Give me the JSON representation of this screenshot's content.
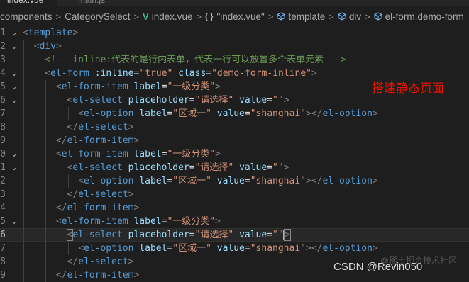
{
  "tabs": {
    "active": "index.vue",
    "inactive": "main.js"
  },
  "breadcrumb": {
    "items": [
      "components",
      "CategorySelect",
      "index.vue",
      "\"index.vue\"",
      "template",
      "div",
      "el-form.demo-form"
    ],
    "icons": [
      "vue-icon",
      "braces-icon",
      "cube-icon"
    ]
  },
  "editor": {
    "line_numbers": [
      "1",
      "2",
      "3",
      "4",
      "5",
      "6",
      "7",
      "8",
      "9",
      "0",
      "1",
      "2",
      "3",
      "4",
      "5",
      "6",
      "7",
      "8",
      "9"
    ],
    "current_line_index": 15,
    "lines": [
      [
        [
          "brk",
          "<"
        ],
        [
          "tag",
          "template"
        ],
        [
          "brk",
          ">"
        ]
      ],
      [
        [
          "brk",
          "<"
        ],
        [
          "tag",
          "div"
        ],
        [
          "brk",
          ">"
        ]
      ],
      [
        [
          "cmt",
          "<!-- inline:代表的是行内表单，代表一行可以放置多个表单元素 -->"
        ]
      ],
      [
        [
          "brk",
          "<"
        ],
        [
          "tag",
          "el-form"
        ],
        [
          "plain",
          " "
        ],
        [
          "attr",
          ":inline"
        ],
        [
          "plain",
          "="
        ],
        [
          "str",
          "\"true\""
        ],
        [
          "plain",
          " "
        ],
        [
          "attr",
          "class"
        ],
        [
          "plain",
          "="
        ],
        [
          "str",
          "\"demo-form-inline\""
        ],
        [
          "brk",
          ">"
        ]
      ],
      [
        [
          "brk",
          "<"
        ],
        [
          "tag",
          "el-form-item"
        ],
        [
          "plain",
          " "
        ],
        [
          "attr",
          "label"
        ],
        [
          "plain",
          "="
        ],
        [
          "str",
          "\"一级分类\""
        ],
        [
          "brk",
          ">"
        ]
      ],
      [
        [
          "brk",
          "<"
        ],
        [
          "tag",
          "el-select"
        ],
        [
          "plain",
          " "
        ],
        [
          "attr",
          "placeholder"
        ],
        [
          "plain",
          "="
        ],
        [
          "str",
          "\"请选择\""
        ],
        [
          "plain",
          " "
        ],
        [
          "attr",
          "value"
        ],
        [
          "plain",
          "="
        ],
        [
          "str",
          "\"\""
        ],
        [
          "brk",
          ">"
        ]
      ],
      [
        [
          "brk",
          "<"
        ],
        [
          "tag",
          "el-option"
        ],
        [
          "plain",
          " "
        ],
        [
          "attr",
          "label"
        ],
        [
          "plain",
          "="
        ],
        [
          "str",
          "\"区域一\""
        ],
        [
          "plain",
          " "
        ],
        [
          "attr",
          "value"
        ],
        [
          "plain",
          "="
        ],
        [
          "str",
          "\"shanghai\""
        ],
        [
          "brk",
          "></"
        ],
        [
          "tag",
          "el-option"
        ],
        [
          "brk",
          ">"
        ]
      ],
      [
        [
          "brk",
          "</"
        ],
        [
          "tag",
          "el-select"
        ],
        [
          "brk",
          ">"
        ]
      ],
      [
        [
          "brk",
          "</"
        ],
        [
          "tag",
          "el-form-item"
        ],
        [
          "brk",
          ">"
        ]
      ],
      [
        [
          "brk",
          "<"
        ],
        [
          "tag",
          "el-form-item"
        ],
        [
          "plain",
          " "
        ],
        [
          "attr",
          "label"
        ],
        [
          "plain",
          "="
        ],
        [
          "str",
          "\"一级分类\""
        ],
        [
          "brk",
          ">"
        ]
      ],
      [
        [
          "brk",
          "<"
        ],
        [
          "tag",
          "el-select"
        ],
        [
          "plain",
          " "
        ],
        [
          "attr",
          "placeholder"
        ],
        [
          "plain",
          "="
        ],
        [
          "str",
          "\"请选择\""
        ],
        [
          "plain",
          " "
        ],
        [
          "attr",
          "value"
        ],
        [
          "plain",
          "="
        ],
        [
          "str",
          "\"\""
        ],
        [
          "brk",
          ">"
        ]
      ],
      [
        [
          "brk",
          "<"
        ],
        [
          "tag",
          "el-option"
        ],
        [
          "plain",
          " "
        ],
        [
          "attr",
          "label"
        ],
        [
          "plain",
          "="
        ],
        [
          "str",
          "\"区域一\""
        ],
        [
          "plain",
          " "
        ],
        [
          "attr",
          "value"
        ],
        [
          "plain",
          "="
        ],
        [
          "str",
          "\"shanghai\""
        ],
        [
          "brk",
          "></"
        ],
        [
          "tag",
          "el-option"
        ],
        [
          "brk",
          ">"
        ]
      ],
      [
        [
          "brk",
          "</"
        ],
        [
          "tag",
          "el-select"
        ],
        [
          "brk",
          ">"
        ]
      ],
      [
        [
          "brk",
          "</"
        ],
        [
          "tag",
          "el-form-item"
        ],
        [
          "brk",
          ">"
        ]
      ],
      [
        [
          "brk",
          "<"
        ],
        [
          "tag",
          "el-form-item"
        ],
        [
          "plain",
          " "
        ],
        [
          "attr",
          "label"
        ],
        [
          "plain",
          "="
        ],
        [
          "str",
          "\"一级分类\""
        ],
        [
          "brk",
          ">"
        ]
      ],
      [
        [
          "brk",
          "<"
        ],
        [
          "tag",
          "el-select"
        ],
        [
          "plain",
          " "
        ],
        [
          "attr",
          "placeholder"
        ],
        [
          "plain",
          "="
        ],
        [
          "str",
          "\"请选择\""
        ],
        [
          "plain",
          " "
        ],
        [
          "attr",
          "value"
        ],
        [
          "plain",
          "="
        ],
        [
          "str",
          "\"\""
        ],
        [
          "brk",
          ">"
        ]
      ],
      [
        [
          "brk",
          "<"
        ],
        [
          "tag",
          "el-option"
        ],
        [
          "plain",
          " "
        ],
        [
          "attr",
          "label"
        ],
        [
          "plain",
          "="
        ],
        [
          "str",
          "\"区域一\""
        ],
        [
          "plain",
          " "
        ],
        [
          "attr",
          "value"
        ],
        [
          "plain",
          "="
        ],
        [
          "str",
          "\"shanghai\""
        ],
        [
          "brk",
          "></"
        ],
        [
          "tag",
          "el-option"
        ],
        [
          "brk",
          ">"
        ]
      ],
      [
        [
          "brk",
          "</"
        ],
        [
          "tag",
          "el-select"
        ],
        [
          "brk",
          ">"
        ]
      ],
      [
        [
          "brk",
          "</"
        ],
        [
          "tag",
          "el-form-item"
        ],
        [
          "brk",
          ">"
        ]
      ]
    ],
    "fold_markers": [
      "⌄",
      "⌄",
      "",
      "⌄",
      "⌄",
      "⌄",
      "",
      "",
      "",
      "⌄",
      "⌄",
      "",
      "",
      "",
      "⌄",
      "",
      "",
      "",
      ""
    ]
  },
  "annotation": "搭建静态页面",
  "watermark": "CSDN @Revin050",
  "watermark_faint": "@稀土掘金技术社区",
  "colors": {
    "annotation": "#e51400",
    "tag": "#569cd6",
    "attribute": "#9cdcfe",
    "string": "#ce9178",
    "comment": "#6a9955"
  }
}
